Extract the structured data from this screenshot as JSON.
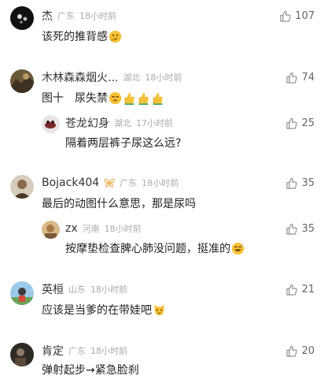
{
  "comments": [
    {
      "name": "杰",
      "location": "广东",
      "time": "18小时前",
      "text": "该死的推背感",
      "likes": "107"
    },
    {
      "name": "木林森森烟火...",
      "location": "湖北",
      "time": "18小时前",
      "text": "图十　尿失禁",
      "likes": "74",
      "reply": {
        "name": "苍龙幻身",
        "location": "湖北",
        "time": "17小时前",
        "text": "隔着两层裤子尿这么远?",
        "likes": "25"
      }
    },
    {
      "name": "Bojack404",
      "location": "广东",
      "time": "18小时前",
      "text": "最后的动图什么意思，那是尿吗",
      "likes": "35",
      "reply": {
        "name": "zx",
        "location": "河南",
        "time": "18小时前",
        "text": "按摩垫检查脾心肺没问题，挺准的",
        "likes": "35"
      }
    },
    {
      "name": "英桓",
      "location": "山东",
      "time": "18小时前",
      "text": "应该是当爹的在带娃吧",
      "likes": "21"
    },
    {
      "name": "肯定",
      "location": "广东",
      "time": "18小时前",
      "text": "弹射起步→紧急脸刹",
      "likes": "20"
    }
  ]
}
